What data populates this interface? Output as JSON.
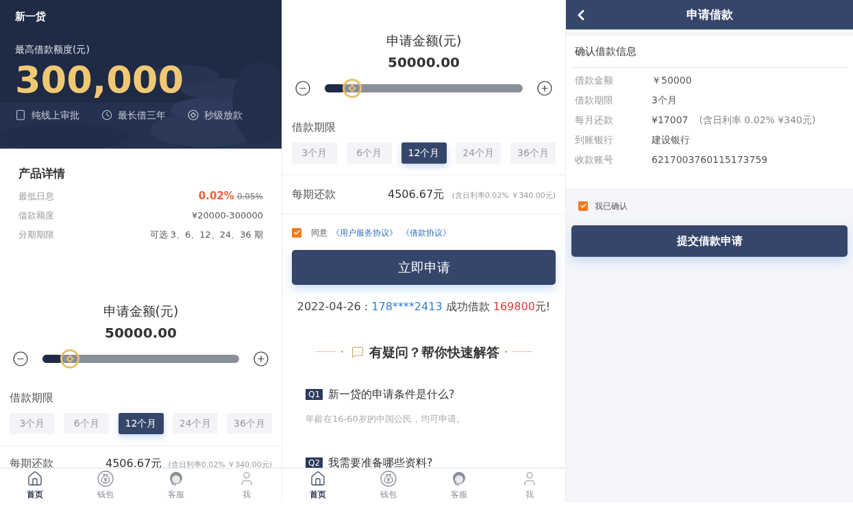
{
  "home": {
    "app_name": "新一贷",
    "limit_label": "最高借款额度(元)",
    "limit_amount": "300,000",
    "features": [
      {
        "kind": "tablet",
        "label": "纯线上审批"
      },
      {
        "kind": "clock",
        "label": "最长借三年"
      },
      {
        "kind": "diamond",
        "label": "秒级放款"
      }
    ],
    "details": {
      "title": "产品详情",
      "rows": [
        {
          "label": "最低日息",
          "value": "0.02%",
          "old_value": "0.05%"
        },
        {
          "label": "借款额度",
          "value": "¥20000-300000"
        },
        {
          "label": "分期期限",
          "value": "可选 3、6、12、24、36 期"
        }
      ]
    },
    "amount": {
      "label": "申请金额(元)",
      "value": "50000.00",
      "level": 0.1
    },
    "term_label": "借款期限",
    "terms": [
      {
        "label": "3个月",
        "selected": false
      },
      {
        "label": "6个月",
        "selected": false
      },
      {
        "label": "12个月",
        "selected": true
      },
      {
        "label": "24个月",
        "selected": false
      },
      {
        "label": "36个月",
        "selected": false
      }
    ],
    "repayment": {
      "label": "每期还款",
      "value": "4506.67元",
      "note": "(含日利率0.02% ￥340.00元)"
    },
    "tab_bar": [
      {
        "kind": "home",
        "label": "首页",
        "selected": true
      },
      {
        "kind": "wallet",
        "label": "钱包",
        "selected": false
      },
      {
        "kind": "service",
        "label": "客服",
        "selected": false
      },
      {
        "kind": "me",
        "label": "我",
        "selected": false
      }
    ]
  },
  "apply": {
    "amount": {
      "label": "申请金额(元)",
      "value": "50000.00",
      "level": 0.1
    },
    "term_label": "借款期限",
    "terms": [
      {
        "label": "3个月",
        "selected": false
      },
      {
        "label": "6个月",
        "selected": false
      },
      {
        "label": "12个月",
        "selected": true
      },
      {
        "label": "24个月",
        "selected": false
      },
      {
        "label": "36个月",
        "selected": false
      }
    ],
    "repayment": {
      "label": "每期还款",
      "value": "4506.67元",
      "note": "(含日利率0.02% ￥340.00元)"
    },
    "agreement": {
      "checked": true,
      "prefix": "同意",
      "links": [
        "《用户服务协议》",
        "《借款协议》"
      ]
    },
    "submit": "立即申请",
    "notice": {
      "date": "2022-04-26 : ",
      "phone": "178****2413",
      "middle": " 成功借款 ",
      "amount": "169800",
      "suffix": "元!"
    },
    "faq": {
      "title": "有疑问？帮你快速解答",
      "items": [
        {
          "tag": "Q1",
          "question": "新一贷的申请条件是什么?",
          "answer": "年龄在16-60岁的中国公民，均可申请。"
        },
        {
          "tag": "Q2",
          "question": "我需要准备哪些资料?"
        }
      ]
    },
    "tab_bar": [
      {
        "kind": "home",
        "label": "首页",
        "selected": true
      },
      {
        "kind": "wallet",
        "label": "钱包",
        "selected": false
      },
      {
        "kind": "service",
        "label": "客服",
        "selected": false
      },
      {
        "kind": "me",
        "label": "我",
        "selected": false
      }
    ]
  },
  "confirm": {
    "title": "申请借款",
    "section_title": "确认借款信息",
    "rows": [
      {
        "label": "借款金额",
        "value": "￥50000"
      },
      {
        "label": "借款期限",
        "value": "3个月"
      },
      {
        "label": "每月还款",
        "value": "¥17007",
        "note": "(含日利率 0.02% ¥340元)"
      },
      {
        "label": "到账银行",
        "value": "建设银行"
      },
      {
        "label": "收款账号",
        "value": "6217003760115173759"
      }
    ],
    "confirmation": {
      "checked": true,
      "label": "我已确认"
    },
    "submit": "提交借款申请"
  }
}
